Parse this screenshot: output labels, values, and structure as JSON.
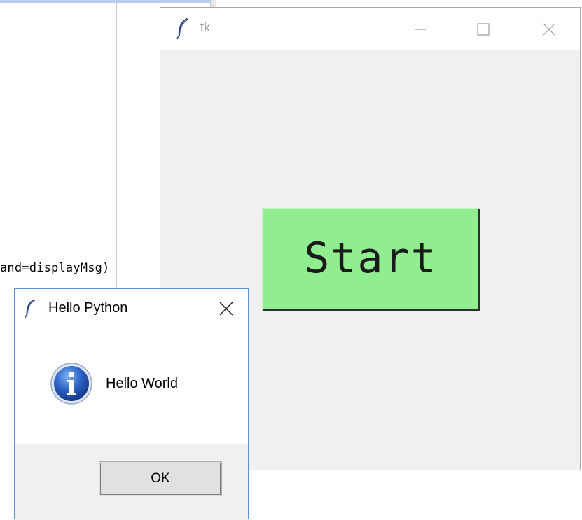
{
  "editor": {
    "code_fragment": "and=displayMsg)"
  },
  "tk_window": {
    "title": "tk",
    "start_button_label": "Start",
    "start_button_color": "#90ee90"
  },
  "message_box": {
    "title": "Hello Python",
    "message": "Hello World",
    "icon": "info-icon",
    "ok_label": "OK"
  }
}
